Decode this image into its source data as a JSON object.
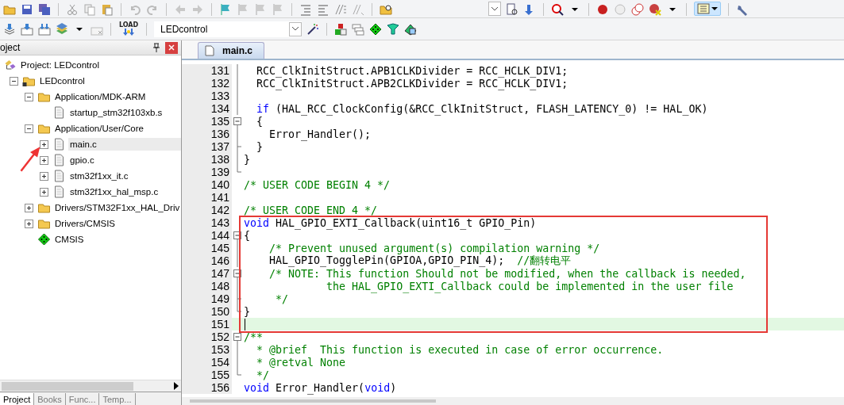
{
  "toolbar": {
    "load_label": "LOAD",
    "target_select": {
      "value": "LEDcontrol"
    }
  },
  "project_panel": {
    "title": "oject",
    "tree": [
      {
        "kind": "project",
        "label": "Project: LEDcontrol",
        "selected": false,
        "children": [
          {
            "kind": "target",
            "label": "LEDcontrol",
            "expanded": true,
            "selected": false,
            "children": [
              {
                "kind": "folder",
                "label": "Application/MDK-ARM",
                "expanded": true,
                "selected": false,
                "children": [
                  {
                    "kind": "file",
                    "label": "startup_stm32f103xb.s",
                    "selected": false
                  }
                ]
              },
              {
                "kind": "folder",
                "label": "Application/User/Core",
                "expanded": true,
                "selected": false,
                "children": [
                  {
                    "kind": "file",
                    "label": "main.c",
                    "expanded": false,
                    "selected": true
                  },
                  {
                    "kind": "file",
                    "label": "gpio.c",
                    "expanded": false,
                    "selected": false
                  },
                  {
                    "kind": "file",
                    "label": "stm32f1xx_it.c",
                    "expanded": false,
                    "selected": false
                  },
                  {
                    "kind": "file",
                    "label": "stm32f1xx_hal_msp.c",
                    "expanded": false,
                    "selected": false
                  }
                ]
              },
              {
                "kind": "folder",
                "label": "Drivers/STM32F1xx_HAL_Driv",
                "expanded": false,
                "selected": false
              },
              {
                "kind": "folder",
                "label": "Drivers/CMSIS",
                "expanded": false,
                "selected": false
              },
              {
                "kind": "component",
                "label": "CMSIS",
                "selected": false
              }
            ]
          }
        ]
      }
    ],
    "tabs": [
      {
        "label": "Project",
        "selected": true
      },
      {
        "label": "Books",
        "selected": false
      },
      {
        "label": "Func...",
        "selected": false
      },
      {
        "label": "Temp...",
        "selected": false
      }
    ]
  },
  "editor": {
    "tabs": [
      {
        "label": "main.c",
        "selected": true
      }
    ],
    "lines": [
      {
        "number": "131",
        "kind": "line",
        "current": false,
        "tokens": [
          {
            "kind": "code",
            "text": "  RCC_ClkInitStruct.APB1CLKDivider = RCC_HCLK_DIV1;"
          }
        ]
      },
      {
        "number": "132",
        "kind": "line",
        "current": false,
        "tokens": [
          {
            "kind": "code",
            "text": "  RCC_ClkInitStruct.APB2CLKDivider = RCC_HCLK_DIV1;"
          }
        ]
      },
      {
        "number": "133",
        "kind": "line",
        "current": false
      },
      {
        "number": "134",
        "kind": "line",
        "current": false,
        "tokens": [
          {
            "kind": "keyword",
            "text": "  if"
          },
          {
            "kind": "code",
            "text": " (HAL_RCC_ClockConfig(&RCC_ClkInitStruct, FLASH_LATENCY_0) != HAL_OK)"
          }
        ]
      },
      {
        "number": "135",
        "kind": "box",
        "current": false,
        "tokens": [
          {
            "kind": "code",
            "text": "  {"
          }
        ]
      },
      {
        "number": "136",
        "kind": "line",
        "current": false,
        "tokens": [
          {
            "kind": "code",
            "text": "    Error_Handler();"
          }
        ]
      },
      {
        "number": "137",
        "kind": "tee",
        "current": false,
        "tokens": [
          {
            "kind": "code",
            "text": "  }"
          }
        ]
      },
      {
        "number": "138",
        "kind": "line",
        "current": false,
        "tokens": [
          {
            "kind": "code",
            "text": "}"
          }
        ]
      },
      {
        "number": "139",
        "kind": "end",
        "current": false
      },
      {
        "number": "140",
        "kind": "none",
        "current": false,
        "tokens": [
          {
            "kind": "comment",
            "text": "/* USER CODE BEGIN 4 */"
          }
        ]
      },
      {
        "number": "141",
        "kind": "none",
        "current": false
      },
      {
        "number": "142",
        "kind": "none",
        "current": false,
        "tokens": [
          {
            "kind": "comment",
            "text": "/* USER CODE END 4 */"
          }
        ]
      },
      {
        "number": "143",
        "kind": "none",
        "current": false,
        "tokens": [
          {
            "kind": "keyword",
            "text": "void"
          },
          {
            "kind": "code",
            "text": " HAL_GPIO_EXTI_Callback(uint16_t GPIO_Pin)"
          }
        ]
      },
      {
        "number": "144",
        "kind": "box",
        "current": false,
        "tokens": [
          {
            "kind": "code",
            "text": "{"
          }
        ]
      },
      {
        "number": "145",
        "kind": "line",
        "current": false,
        "tokens": [
          {
            "kind": "comment",
            "text": "    /* Prevent unused argument(s) compilation warning */"
          }
        ]
      },
      {
        "number": "146",
        "kind": "line",
        "current": false,
        "tokens": [
          {
            "kind": "code",
            "text": "    HAL_GPIO_TogglePin(GPIOA,GPIO_PIN_4);  "
          },
          {
            "kind": "comment",
            "text": "//翻转电平"
          }
        ]
      },
      {
        "number": "147",
        "kind": "box",
        "current": false,
        "tokens": [
          {
            "kind": "comment",
            "text": "    /* NOTE: This function Should not be modified, when the callback is needed,"
          }
        ]
      },
      {
        "number": "148",
        "kind": "line",
        "current": false,
        "tokens": [
          {
            "kind": "comment",
            "text": "             the HAL_GPIO_EXTI_Callback could be implemented in the user file"
          }
        ]
      },
      {
        "number": "149",
        "kind": "tee",
        "current": false,
        "tokens": [
          {
            "kind": "comment",
            "text": "     */"
          }
        ]
      },
      {
        "number": "150",
        "kind": "end",
        "current": false,
        "tokens": [
          {
            "kind": "code",
            "text": "}"
          }
        ]
      },
      {
        "number": "151",
        "kind": "none",
        "current": true
      },
      {
        "number": "152",
        "kind": "box",
        "current": false,
        "tokens": [
          {
            "kind": "comment",
            "text": "/**"
          }
        ]
      },
      {
        "number": "153",
        "kind": "line",
        "current": false,
        "tokens": [
          {
            "kind": "comment",
            "text": "  * @brief  This function is executed in case of error occurrence."
          }
        ]
      },
      {
        "number": "154",
        "kind": "line",
        "current": false,
        "tokens": [
          {
            "kind": "comment",
            "text": "  * @retval None"
          }
        ]
      },
      {
        "number": "155",
        "kind": "end",
        "current": false,
        "tokens": [
          {
            "kind": "comment",
            "text": "  */"
          }
        ]
      },
      {
        "number": "156",
        "kind": "none",
        "current": false,
        "tokens": [
          {
            "kind": "keyword",
            "text": "void"
          },
          {
            "kind": "code",
            "text": " Error_Handler("
          },
          {
            "kind": "keyword",
            "text": "void"
          },
          {
            "kind": "code",
            "text": ")"
          }
        ]
      }
    ]
  }
}
